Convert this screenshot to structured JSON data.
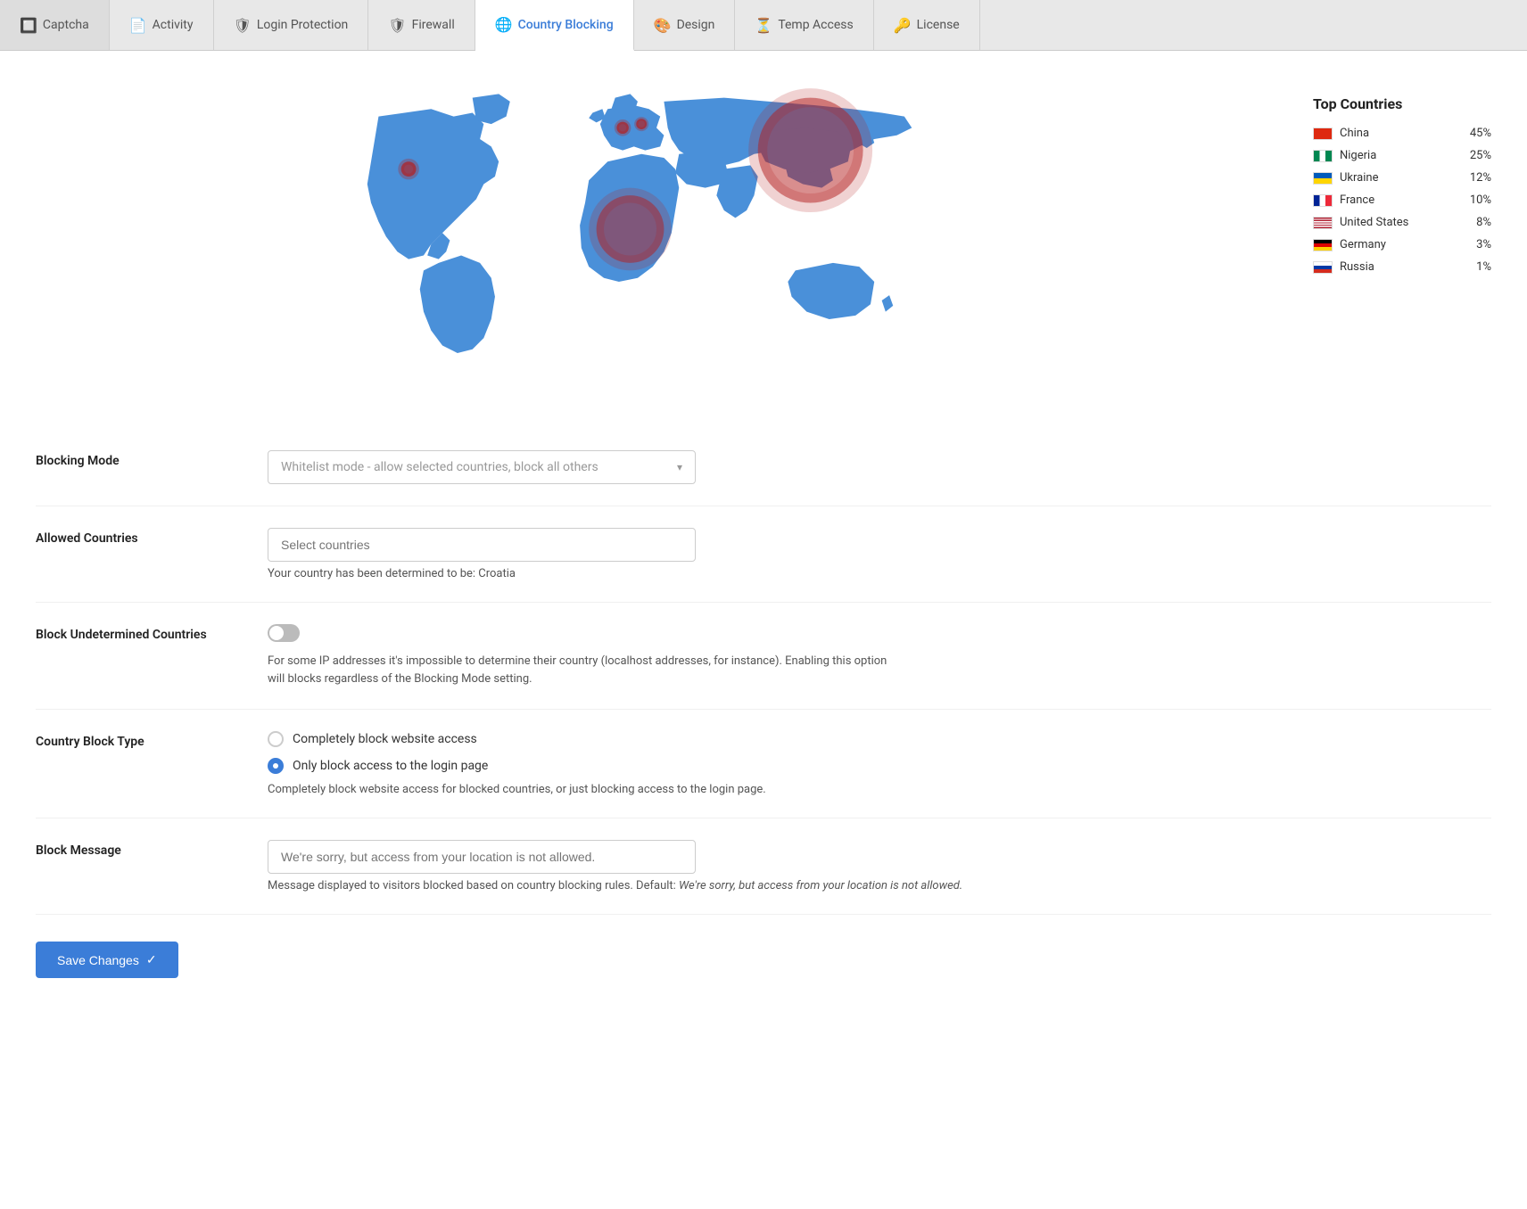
{
  "tabs": [
    {
      "id": "captcha",
      "label": "Captcha",
      "icon": "🔲",
      "active": false
    },
    {
      "id": "activity",
      "label": "Activity",
      "icon": "📄",
      "active": false
    },
    {
      "id": "login-protection",
      "label": "Login Protection",
      "icon": "🛡",
      "active": false
    },
    {
      "id": "firewall",
      "label": "Firewall",
      "icon": "🛡",
      "active": false
    },
    {
      "id": "country-blocking",
      "label": "Country Blocking",
      "icon": "🌐",
      "active": true
    },
    {
      "id": "design",
      "label": "Design",
      "icon": "🎨",
      "active": false
    },
    {
      "id": "temp-access",
      "label": "Temp Access",
      "icon": "⏳",
      "active": false
    },
    {
      "id": "license",
      "label": "License",
      "icon": "🔑",
      "active": false
    }
  ],
  "map": {
    "top_countries_heading": "Top Countries",
    "countries": [
      {
        "name": "China",
        "pct": "45%",
        "flag_class": "flag-china"
      },
      {
        "name": "Nigeria",
        "pct": "25%",
        "flag_class": "flag-nigeria"
      },
      {
        "name": "Ukraine",
        "pct": "12%",
        "flag_class": "flag-ukraine"
      },
      {
        "name": "France",
        "pct": "10%",
        "flag_class": "flag-france"
      },
      {
        "name": "United States",
        "pct": "8%",
        "flag_class": "flag-us"
      },
      {
        "name": "Germany",
        "pct": "3%",
        "flag_class": "flag-germany"
      },
      {
        "name": "Russia",
        "pct": "1%",
        "flag_class": "flag-russia"
      }
    ]
  },
  "settings": {
    "blocking_mode": {
      "label": "Blocking Mode",
      "value": "Whitelist mode - allow selected countries, block all others",
      "placeholder": "Whitelist mode - allow selected countries, block all others"
    },
    "allowed_countries": {
      "label": "Allowed Countries",
      "placeholder": "Select countries",
      "hint": "Your country has been determined to be: Croatia"
    },
    "block_undetermined": {
      "label": "Block Undetermined Countries",
      "enabled": false,
      "description": "For some IP addresses it's impossible to determine their country (localhost addresses, for instance). Enabling this option will blocks regardless of the Blocking Mode setting."
    },
    "country_block_type": {
      "label": "Country Block Type",
      "options": [
        {
          "id": "complete",
          "label": "Completely block website access",
          "selected": false
        },
        {
          "id": "login",
          "label": "Only block access to the login page",
          "selected": true
        }
      ],
      "description": "Completely block website access for blocked countries, or just blocking access to the login page."
    },
    "block_message": {
      "label": "Block Message",
      "placeholder": "We're sorry, but access from your location is not allowed.",
      "description": "Message displayed to visitors blocked based on country blocking rules. Default: ",
      "default_text": "We're sorry, but access from your location is not allowed."
    }
  },
  "save_button": {
    "label": "Save Changes",
    "icon": "✓"
  }
}
